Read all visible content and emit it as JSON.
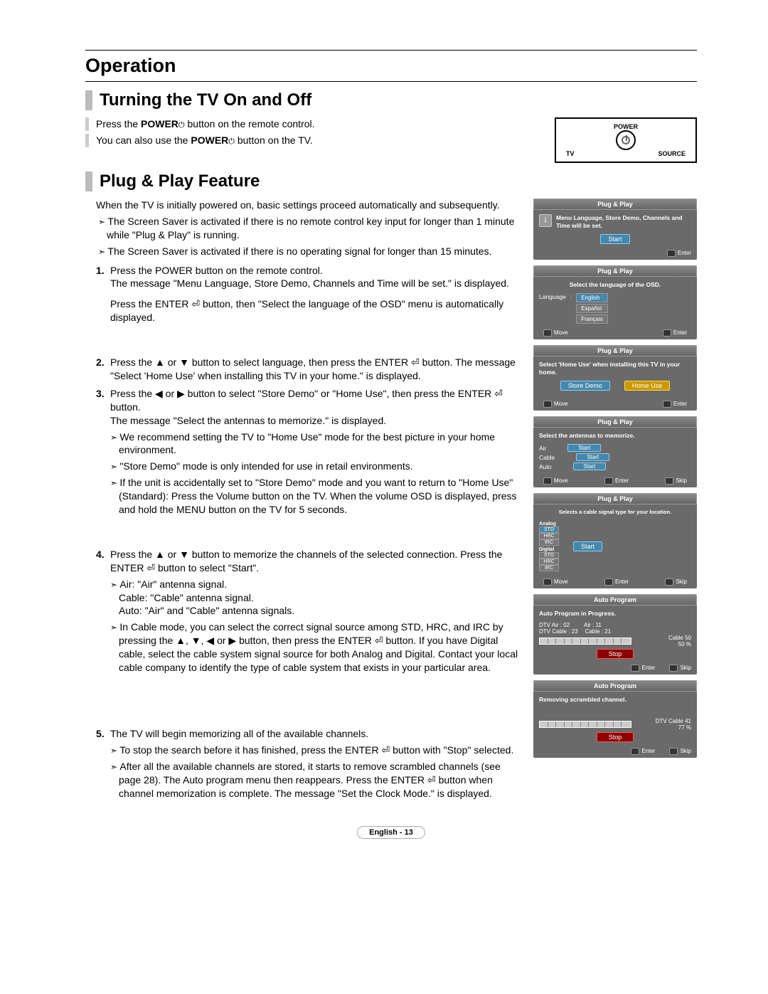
{
  "header": {
    "title": "Operation"
  },
  "section1": {
    "title": "Turning the TV On and Off",
    "line1_a": "Press the ",
    "line1_b": "POWER",
    "line1_c": " button on the remote control.",
    "line2_a": "You can also use the ",
    "line2_b": "POWER",
    "line2_c": " button on the TV."
  },
  "remote": {
    "power": "POWER",
    "tv": "TV",
    "source": "SOURCE"
  },
  "section2": {
    "title": "Plug & Play Feature",
    "intro": "When the TV is initially powered on, basic settings proceed automatically and subsequently.",
    "note1": "The Screen Saver is activated if there is no remote control key input for longer than 1 minute while \"Plug & Play\" is running.",
    "note2": "The Screen Saver is activated if there is no operating signal for longer than 15 minutes.",
    "step1_a": "Press the POWER button on the remote control.\nThe message \"Menu Language, Store Demo, Channels and Time will be set.\" is displayed.",
    "step1_b": "Press the ENTER ⏎ button, then \"Select the language of the OSD\" menu is automatically displayed.",
    "step2": "Press the ▲ or ▼ button to select language, then press the ENTER ⏎ button. The message \"Select 'Home Use' when installing this TV in your home.\" is displayed.",
    "step3_a": "Press the ◀ or ▶ button to select \"Store Demo\" or \"Home Use\", then press the ENTER ⏎ button.\nThe message \"Select the antennas to memorize.\" is displayed.",
    "step3_n1": "We recommend setting the TV to \"Home Use\" mode for the best picture in your home environment.",
    "step3_n2": "\"Store Demo\" mode is only intended for use in retail environments.",
    "step3_n3": "If the unit is accidentally set to \"Store Demo\" mode and you want to return to \"Home Use\" (Standard): Press the Volume button on the TV. When the volume OSD is displayed, press and hold the MENU button on the TV for 5 seconds.",
    "step4_a": "Press the ▲ or ▼ button to memorize the channels of the selected connection. Press the ENTER ⏎ button to select \"Start\".",
    "step4_n1": "Air: \"Air\" antenna signal.\nCable: \"Cable\" antenna signal.\nAuto: \"Air\" and \"Cable\" antenna signals.",
    "step4_n2": "In Cable mode, you can select the correct signal source among STD, HRC, and IRC by pressing the ▲, ▼, ◀ or ▶ button, then press the ENTER ⏎ button. If you have Digital cable, select the cable system signal source for both Analog and Digital. Contact your local cable company to identify the type of cable system that exists in your particular area.",
    "step5_a": "The TV will begin memorizing all of the available channels.",
    "step5_n1": "To stop the search before it has finished, press the ENTER ⏎ button with \"Stop\" selected.",
    "step5_n2": "After all the available channels are stored, it starts to remove scrambled channels (see page 28). The Auto program menu then reappears. Press the ENTER ⏎ button when channel memorization is complete. The message \"Set the Clock Mode.\" is displayed."
  },
  "osd": {
    "pp": "Plug & Play",
    "ap": "Auto Program",
    "panel1_msg": "Menu Language, Store Demo, Channels and Time will be set.",
    "start": "Start",
    "enter": "Enter",
    "move": "Move",
    "skip": "Skip",
    "panel2_msg": "Select the language of the OSD.",
    "lang_label": "Language",
    "langs": [
      "English",
      "Español",
      "Français"
    ],
    "panel3_msg": "Select 'Home Use' when installing this TV in your home.",
    "store_demo": "Store Demo",
    "home_use": "Home Use",
    "panel4_msg": "Select the antennas to memorize.",
    "ant": [
      "Air",
      "Cable",
      "Auto"
    ],
    "panel5_msg": "Selects a cable signal type for your location.",
    "analog": "Analog",
    "digital": "Digital",
    "sig": [
      "STD",
      "HRC",
      "IRC"
    ],
    "panel6_msg": "Auto Program in Progress.",
    "panel6_l1": "DTV Air : 02",
    "panel6_l2": "Air : 11",
    "panel6_l3": "DTV Cable : 23",
    "panel6_l4": "Cable : 21",
    "panel6_r1": "Cable   50",
    "panel6_r2": "50   %",
    "stop": "Stop",
    "panel7_msg": "Removing scrambled channel.",
    "panel7_r1": "DTV Cable   41",
    "panel7_r2": "77   %"
  },
  "footer": {
    "text": "English - 13"
  }
}
